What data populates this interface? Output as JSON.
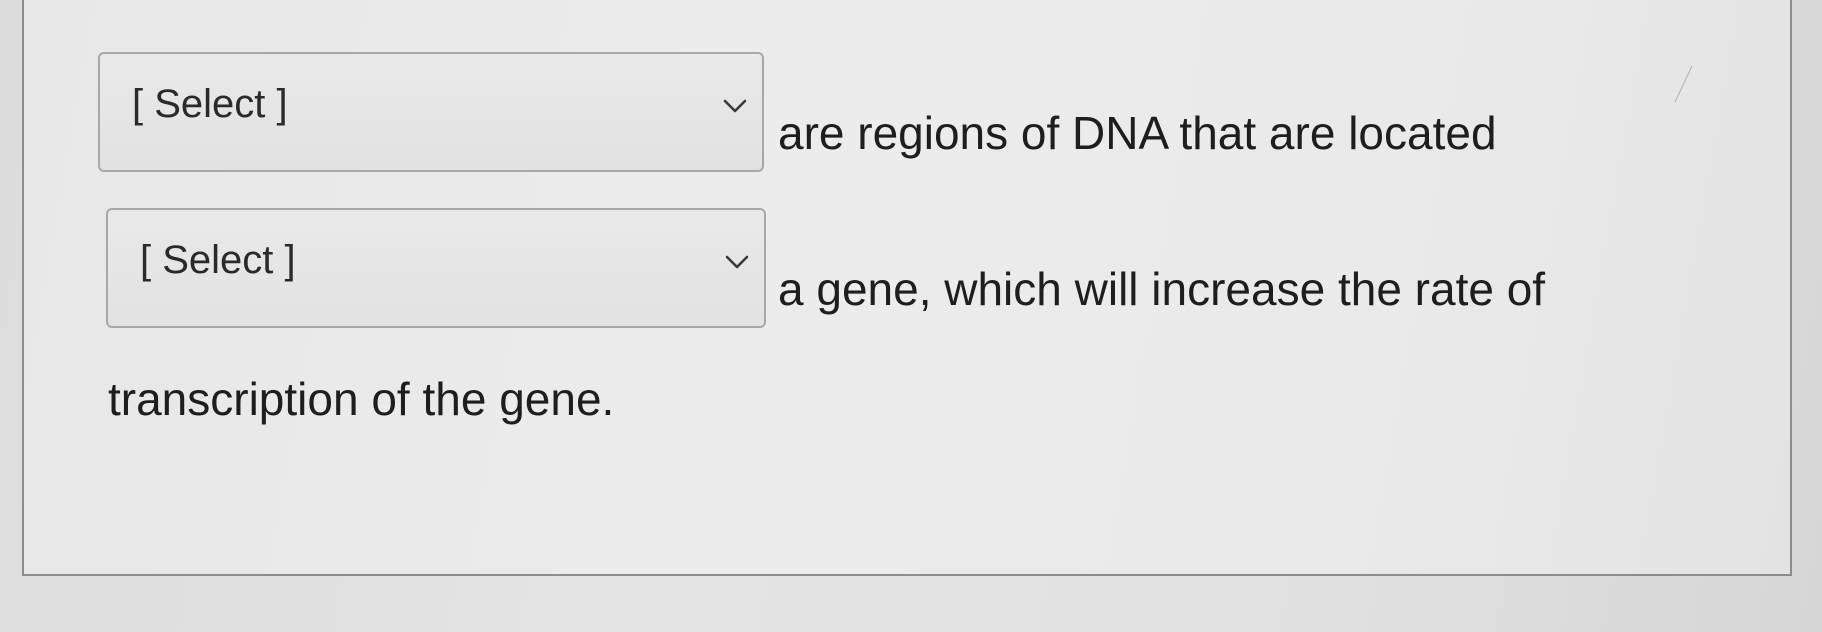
{
  "question": {
    "dropdown_1": {
      "selected": "[ Select ]",
      "icon": "chevron-down-icon"
    },
    "text_after_dropdown_1": "are regions of DNA that are located",
    "dropdown_2": {
      "selected": "[ Select ]",
      "icon": "chevron-down-icon"
    },
    "text_after_dropdown_2": "a gene, which will increase the rate of",
    "text_end": "transcription of the gene."
  },
  "colors": {
    "background": "#e4e4e4",
    "card_border": "#8c8c8c",
    "select_border": "#a8a8a8",
    "text": "#1e1e1e"
  }
}
